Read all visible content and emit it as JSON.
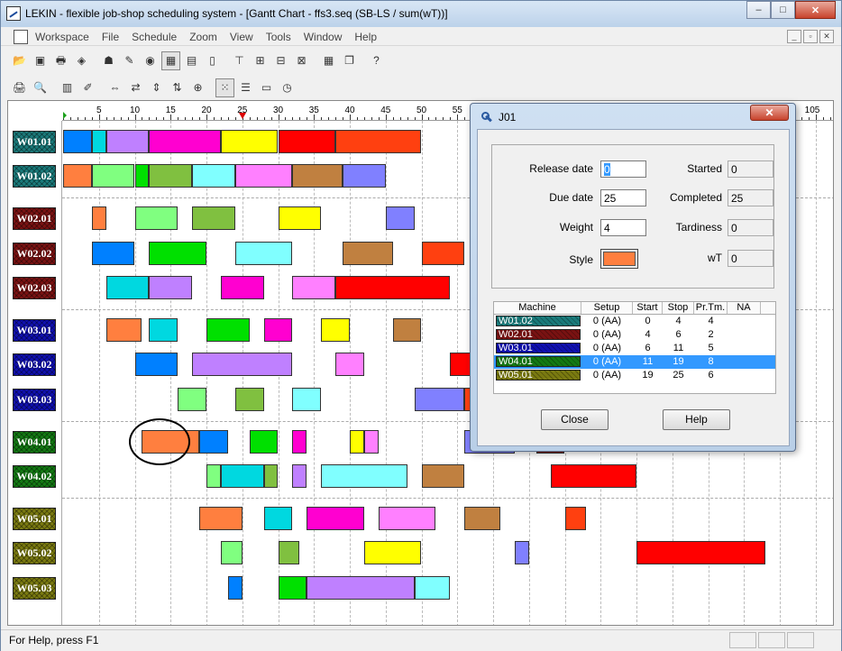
{
  "window": {
    "title": "LEKIN - flexible job-shop scheduling system - [Gantt Chart - ffs3.seq (SB-LS / sum(wT))]",
    "controls": [
      "–",
      "□",
      "✕"
    ]
  },
  "menu": {
    "items": [
      "Workspace",
      "File",
      "Schedule",
      "Zoom",
      "View",
      "Tools",
      "Window",
      "Help"
    ],
    "mdi_controls": [
      "_",
      "▫",
      "✕"
    ]
  },
  "toolbar1": [
    {
      "name": "open-icon",
      "glyph": "📂"
    },
    {
      "name": "copy-icon",
      "glyph": "▣"
    },
    {
      "name": "print-icon",
      "glyph": "🖶"
    },
    {
      "name": "diamond-icon",
      "glyph": "◈"
    },
    {
      "name": "jobs-icon",
      "glyph": "☗"
    },
    {
      "name": "wrench-icon",
      "glyph": "✎"
    },
    {
      "name": "globe-icon",
      "glyph": "◉"
    },
    {
      "name": "gantt-icon",
      "glyph": "▦"
    },
    {
      "name": "chart-icon",
      "glyph": "▤"
    },
    {
      "name": "doc-icon",
      "glyph": "▯"
    },
    {
      "name": "schedule1-icon",
      "glyph": "⊤"
    },
    {
      "name": "schedule2-icon",
      "glyph": "⊞"
    },
    {
      "name": "schedule3-icon",
      "glyph": "⊟"
    },
    {
      "name": "schedule4-icon",
      "glyph": "⊠"
    },
    {
      "name": "grid-icon",
      "glyph": "▦"
    },
    {
      "name": "windows-icon",
      "glyph": "❐"
    },
    {
      "name": "help-icon",
      "glyph": "?"
    }
  ],
  "toolbar2": [
    {
      "name": "printer-icon",
      "glyph": "🖨"
    },
    {
      "name": "preview-icon",
      "glyph": "🔍"
    },
    {
      "name": "bar-chart-icon",
      "glyph": "▥"
    },
    {
      "name": "pen-icon",
      "glyph": "✐"
    },
    {
      "name": "zoom-in-h-icon",
      "glyph": "⇔"
    },
    {
      "name": "zoom-out-h-icon",
      "glyph": "⇄"
    },
    {
      "name": "zoom-in-v-icon",
      "glyph": "⇕"
    },
    {
      "name": "zoom-out-v-icon",
      "glyph": "⇅"
    },
    {
      "name": "fit-icon",
      "glyph": "⊕"
    },
    {
      "name": "dots-icon",
      "glyph": "⁙"
    },
    {
      "name": "list-icon",
      "glyph": "☰"
    },
    {
      "name": "card-icon",
      "glyph": "▭"
    },
    {
      "name": "clock-icon",
      "glyph": "◷"
    }
  ],
  "gantt": {
    "ticks": [
      "5",
      "10",
      "15",
      "20",
      "25",
      "30",
      "35",
      "40",
      "45",
      "50",
      "55",
      "105"
    ],
    "workstations": [
      {
        "label": "W01.01",
        "color": "#1a7a7a"
      },
      {
        "label": "W01.02",
        "color": "#1a7a7a"
      },
      {
        "label": "W02.01",
        "color": "#7a1212"
      },
      {
        "label": "W02.02",
        "color": "#7a1212"
      },
      {
        "label": "W02.03",
        "color": "#7a1212"
      },
      {
        "label": "W03.01",
        "color": "#1010b0"
      },
      {
        "label": "W03.02",
        "color": "#1010b0"
      },
      {
        "label": "W03.03",
        "color": "#1010b0"
      },
      {
        "label": "W04.01",
        "color": "#137a13"
      },
      {
        "label": "W04.02",
        "color": "#137a13"
      },
      {
        "label": "W05.01",
        "color": "#7a7a10"
      },
      {
        "label": "W05.02",
        "color": "#7a7a10"
      },
      {
        "label": "W05.03",
        "color": "#7a7a10"
      }
    ],
    "blocks": [
      [
        [
          0,
          4,
          "#0080ff"
        ],
        [
          4,
          6,
          "#00d8e0"
        ],
        [
          6,
          12,
          "#bf80ff"
        ],
        [
          12,
          22,
          "#ff00d0"
        ],
        [
          22,
          30,
          "#ffff00"
        ],
        [
          30,
          38,
          "#ff0000"
        ],
        [
          38,
          50,
          "#ff4010"
        ]
      ],
      [
        [
          0,
          4,
          "#ff7f3f"
        ],
        [
          4,
          10,
          "#80ff80"
        ],
        [
          10,
          12,
          "#00e000"
        ],
        [
          12,
          18,
          "#80c040"
        ],
        [
          18,
          24,
          "#80ffff"
        ],
        [
          24,
          32,
          "#ff80ff"
        ],
        [
          32,
          39,
          "#c08040"
        ],
        [
          39,
          45,
          "#8080ff"
        ]
      ],
      [
        [
          4,
          6,
          "#ff7f3f"
        ],
        [
          10,
          16,
          "#80ff80"
        ],
        [
          18,
          24,
          "#80c040"
        ],
        [
          30,
          36,
          "#ffff00"
        ],
        [
          45,
          49,
          "#8080ff"
        ]
      ],
      [
        [
          4,
          10,
          "#0080ff"
        ],
        [
          12,
          20,
          "#00e000"
        ],
        [
          24,
          32,
          "#80ffff"
        ],
        [
          39,
          46,
          "#c08040"
        ],
        [
          50,
          56,
          "#ff4010"
        ]
      ],
      [
        [
          6,
          12,
          "#00d8e0"
        ],
        [
          12,
          18,
          "#bf80ff"
        ],
        [
          22,
          28,
          "#ff00d0"
        ],
        [
          32,
          38,
          "#ff80ff"
        ],
        [
          38,
          54,
          "#ff0000"
        ]
      ],
      [
        [
          6,
          11,
          "#ff7f3f"
        ],
        [
          12,
          16,
          "#00d8e0"
        ],
        [
          20,
          26,
          "#00e000"
        ],
        [
          28,
          32,
          "#ff00d0"
        ],
        [
          36,
          40,
          "#ffff00"
        ],
        [
          46,
          50,
          "#c08040"
        ]
      ],
      [
        [
          10,
          16,
          "#0080ff"
        ],
        [
          18,
          32,
          "#bf80ff"
        ],
        [
          38,
          42,
          "#ff80ff"
        ],
        [
          54,
          58,
          "#ff0000"
        ]
      ],
      [
        [
          16,
          20,
          "#80ff80"
        ],
        [
          24,
          28,
          "#80c040"
        ],
        [
          32,
          36,
          "#80ffff"
        ],
        [
          49,
          56,
          "#8080ff"
        ],
        [
          56,
          58,
          "#ff4010"
        ]
      ],
      [
        [
          11,
          19,
          "#ff7f3f"
        ],
        [
          19,
          23,
          "#0080ff"
        ],
        [
          26,
          30,
          "#00e000"
        ],
        [
          32,
          34,
          "#ff00d0"
        ],
        [
          40,
          42,
          "#ffff00"
        ],
        [
          42,
          44,
          "#ff80ff"
        ],
        [
          56,
          63,
          "#8080ff"
        ],
        [
          66,
          70,
          "#7a1a0a"
        ]
      ],
      [
        [
          20,
          22,
          "#80ff80"
        ],
        [
          22,
          28,
          "#00d8e0"
        ],
        [
          28,
          30,
          "#80c040"
        ],
        [
          32,
          34,
          "#bf80ff"
        ],
        [
          36,
          48,
          "#80ffff"
        ],
        [
          50,
          56,
          "#c08040"
        ],
        [
          68,
          80,
          "#ff0000"
        ]
      ],
      [
        [
          19,
          25,
          "#ff7f3f"
        ],
        [
          28,
          32,
          "#00d8e0"
        ],
        [
          34,
          42,
          "#ff00d0"
        ],
        [
          44,
          52,
          "#ff80ff"
        ],
        [
          56,
          61,
          "#c08040"
        ],
        [
          70,
          73,
          "#ff4010"
        ]
      ],
      [
        [
          22,
          25,
          "#80ff80"
        ],
        [
          30,
          33,
          "#80c040"
        ],
        [
          42,
          50,
          "#ffff00"
        ],
        [
          63,
          65,
          "#8080ff"
        ],
        [
          80,
          98,
          "#ff0000"
        ]
      ],
      [
        [
          23,
          25,
          "#0080ff"
        ],
        [
          30,
          34,
          "#00e000"
        ],
        [
          34,
          49,
          "#bf80ff"
        ],
        [
          49,
          54,
          "#80ffff"
        ]
      ]
    ],
    "release_marker": 0,
    "due_marker": 25
  },
  "dialog": {
    "title": "J01",
    "fields": {
      "release_date": {
        "label": "Release date",
        "value": "0"
      },
      "due_date": {
        "label": "Due date",
        "value": "25"
      },
      "weight": {
        "label": "Weight",
        "value": "4"
      },
      "style": {
        "label": "Style",
        "color": "#ff7f3f"
      },
      "started": {
        "label": "Started",
        "value": "0"
      },
      "completed": {
        "label": "Completed",
        "value": "25"
      },
      "tardiness": {
        "label": "Tardiness",
        "value": "0"
      },
      "wt": {
        "label": "wT",
        "value": "0"
      }
    },
    "table": {
      "headers": [
        "Machine",
        "Setup",
        "Start",
        "Stop",
        "Pr.Tm.",
        "NA"
      ],
      "rows": [
        {
          "machine": "W01.02",
          "color": "#1a7a7a",
          "setup": "0 (AA)",
          "start": "0",
          "stop": "4",
          "prtm": "4",
          "selected": false
        },
        {
          "machine": "W02.01",
          "color": "#7a1212",
          "setup": "0 (AA)",
          "start": "4",
          "stop": "6",
          "prtm": "2",
          "selected": false
        },
        {
          "machine": "W03.01",
          "color": "#1010b0",
          "setup": "0 (AA)",
          "start": "6",
          "stop": "11",
          "prtm": "5",
          "selected": false
        },
        {
          "machine": "W04.01",
          "color": "#137a13",
          "setup": "0 (AA)",
          "start": "11",
          "stop": "19",
          "prtm": "8",
          "selected": true
        },
        {
          "machine": "W05.01",
          "color": "#7a7a10",
          "setup": "0 (AA)",
          "start": "19",
          "stop": "25",
          "prtm": "6",
          "selected": false
        }
      ]
    },
    "buttons": {
      "close": "Close",
      "help": "Help"
    },
    "close_glyph": "✕"
  },
  "status": {
    "text": "For Help, press F1"
  }
}
